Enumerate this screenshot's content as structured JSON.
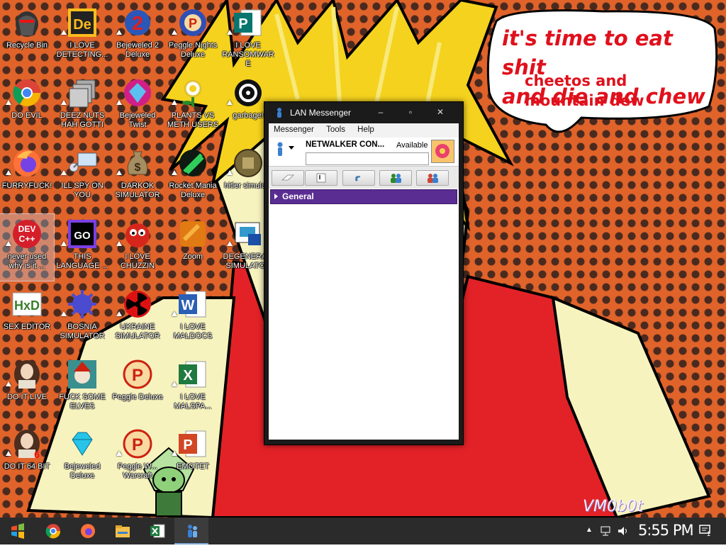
{
  "desktop": {
    "icons": [
      {
        "label": "Recycle Bin"
      },
      {
        "label": "I LOVE DETECTING..."
      },
      {
        "label": "Bejeweled 2 Deluxe"
      },
      {
        "label": "Peggle Nights Deluxe"
      },
      {
        "label": "I LOVE RANSOMWARE"
      },
      {
        "label": "DO EVIL"
      },
      {
        "label": "DEEZ NUTS HAH GOTTI"
      },
      {
        "label": "Bejeweled Twist"
      },
      {
        "label": "PLANTS VS METH USERS"
      },
      {
        "label": "garbage!"
      },
      {
        "label": "FURRYFUCK!"
      },
      {
        "label": "ILL SPY ON YOU"
      },
      {
        "label": "DARKOK SIMULATOR"
      },
      {
        "label": "Rocket Mania Deluxe"
      },
      {
        "label": "hitler simula..."
      },
      {
        "label": "never used why is it ..."
      },
      {
        "label": "THIS LANGUAGE ..."
      },
      {
        "label": "I LOVE CHUZZIN"
      },
      {
        "label": "Zoom"
      },
      {
        "label": "DEGENERA... SIMULATOR"
      },
      {
        "label": "SEX EDITOR"
      },
      {
        "label": "BOSNIA SIMULATOR"
      },
      {
        "label": "UKRAINE SIMULATOR"
      },
      {
        "label": "I LOVE MALDOCS"
      },
      {
        "label": "DO IT LIVE"
      },
      {
        "label": "FUCK SOME ELVES"
      },
      {
        "label": "Peggle Deluxe"
      },
      {
        "label": "I LOVE MALSPA..."
      },
      {
        "label": "DO IT 64 BIT"
      },
      {
        "label": "Bejeweled Deluxe"
      },
      {
        "label": "Peggle W... Warcraft"
      },
      {
        "label": "EMOTET"
      }
    ],
    "icon_glyphs": {
      "dev_cpp_line1": "DEV",
      "dev_cpp_line2": "C++",
      "goland": "GO",
      "hxd": "HxD",
      "word": "W",
      "excel": "X",
      "powerpoint": "P",
      "peggle": "P",
      "dollar": "$",
      "bejeweled2": "2",
      "de": "De"
    }
  },
  "wallpaper": {
    "bubble_line1": "it's time to eat shit",
    "bubble_line2": "and die and chew",
    "bubble_line3": "cheetos and",
    "bubble_line4": "mountain dew",
    "watermark": "VM0b0t"
  },
  "lan_messenger": {
    "title": "LAN Messenger",
    "menu": [
      "Messenger",
      "Tools",
      "Help"
    ],
    "user_name": "NETWALKER CON...",
    "status": "Available",
    "note": "",
    "group": "General"
  },
  "taskbar": {
    "time": "5:55 PM",
    "notification_count": "1"
  },
  "colors": {
    "wallpaper_orange": "#e0632a",
    "hair_yellow": "#f5d21e",
    "shirt_red": "#e32227",
    "group_purple": "#5a2d92",
    "bubble_text_red": "#e0101c"
  }
}
